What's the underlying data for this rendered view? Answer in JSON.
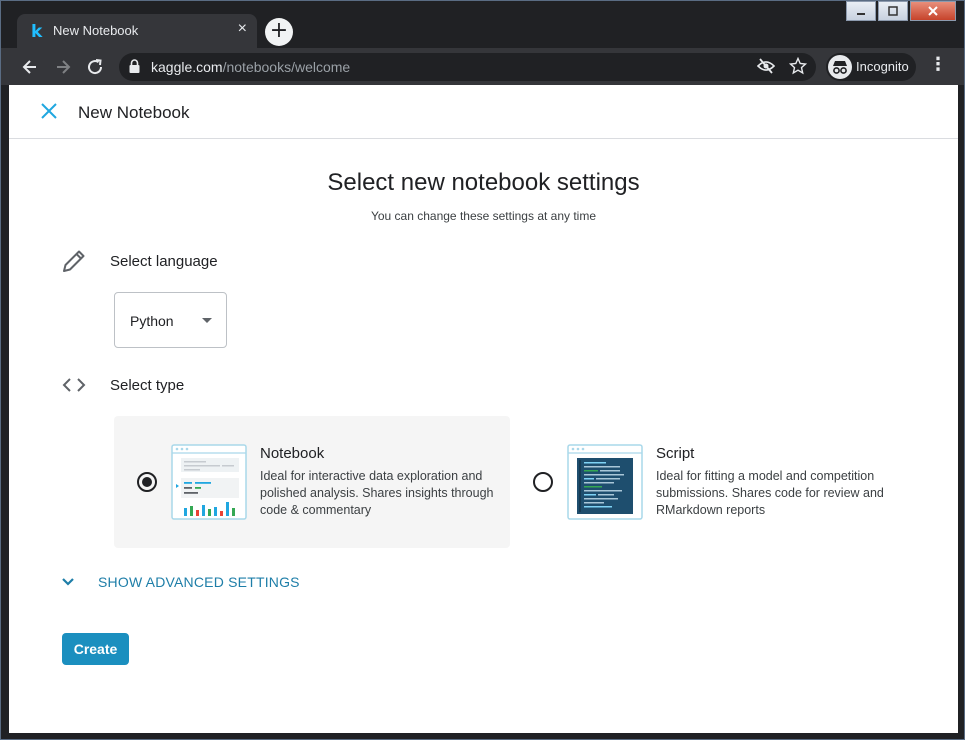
{
  "browser": {
    "tab_title": "New Notebook",
    "tab_logo": "k",
    "url_host": "kaggle.com",
    "url_path": "/notebooks/welcome",
    "incognito_label": "Incognito",
    "new_tab_glyph": "+",
    "tab_close_glyph": "×",
    "menu_glyph": "⋮"
  },
  "header": {
    "title": "New Notebook"
  },
  "main": {
    "title": "Select new notebook settings",
    "subtitle": "You can change these settings at any time"
  },
  "language": {
    "label": "Select language",
    "selected": "Python"
  },
  "type": {
    "label": "Select type",
    "options": [
      {
        "name": "Notebook",
        "description": "Ideal for interactive data exploration and polished analysis. Shares insights through code & commentary",
        "selected": true
      },
      {
        "name": "Script",
        "description": "Ideal for fitting a model and competition submissions. Shares code for review and RMarkdown reports",
        "selected": false
      }
    ]
  },
  "advanced": {
    "label": "SHOW ADVANCED SETTINGS"
  },
  "actions": {
    "create_label": "Create"
  },
  "colors": {
    "accent": "#1b8fbf",
    "link": "#1e7ea8",
    "kaggle_blue": "#20beff"
  }
}
